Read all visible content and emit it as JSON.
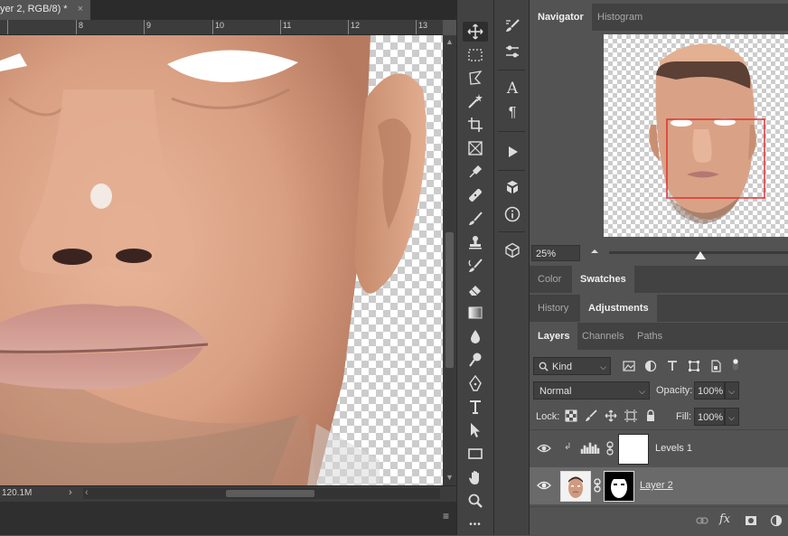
{
  "document": {
    "tab_title": "yer 2, RGB/8) *",
    "tab_close": "×",
    "ruler_labels": [
      "8",
      "9",
      "10",
      "11",
      "12",
      "13"
    ],
    "status_value": "120.1M",
    "status_chevron": "›",
    "scroll_left_arrow": "‹",
    "scroll_up_arrow": "▲",
    "scroll_down_arrow": "▼",
    "bottom_menu_icon": "≡"
  },
  "toolbar": {
    "tools": [
      "move-tool",
      "marquee-tool",
      "lasso-tool",
      "quick-select-tool",
      "crop-tool",
      "frame-tool",
      "eyedropper-tool",
      "healing-tool",
      "brush-tool",
      "clone-stamp-tool",
      "history-brush-tool",
      "eraser-tool",
      "gradient-tool",
      "blur-tool",
      "dodge-tool",
      "pen-tool",
      "type-tool",
      "path-select-tool",
      "rectangle-tool",
      "hand-tool",
      "zoom-tool",
      "more-tools"
    ],
    "more_glyph": "•••"
  },
  "dock": {
    "type_glyph": "A",
    "para_glyph": "¶"
  },
  "navigator": {
    "tabs": [
      "Navigator",
      "Histogram"
    ],
    "active_tab": "Navigator",
    "zoom": "25%"
  },
  "color_tabs": {
    "tabs": [
      "Color",
      "Swatches"
    ],
    "active_tab": "Swatches"
  },
  "adjust_tabs": {
    "tabs": [
      "History",
      "Adjustments"
    ],
    "active_tab": "Adjustments"
  },
  "layers_panel": {
    "tabs": [
      "Layers",
      "Channels",
      "Paths"
    ],
    "active_tab": "Layers",
    "filter_label": "Kind",
    "blend_mode": "Normal",
    "opacity_label": "Opacity:",
    "opacity_value": "100%",
    "lock_label": "Lock:",
    "fill_label": "Fill:",
    "fill_value": "100%",
    "layers": [
      {
        "name": "Levels 1",
        "visible": true,
        "selected": false
      },
      {
        "name": "Layer 2",
        "visible": true,
        "selected": true
      }
    ],
    "footer_fx": "fx"
  },
  "colors": {
    "selected_row": "#6a6a6a",
    "nav_proxy_box": "#e03030"
  }
}
